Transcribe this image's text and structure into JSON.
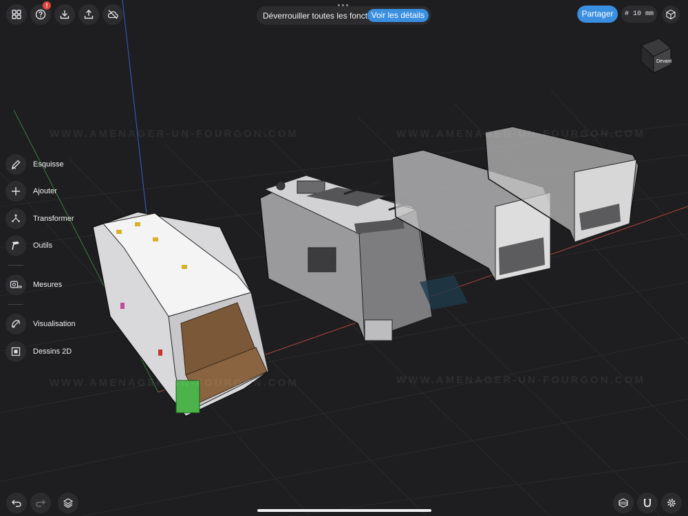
{
  "toolbar": {
    "left_icons": [
      "grid-icon",
      "help-icon",
      "download-icon",
      "upload-icon",
      "cloud-off-icon"
    ],
    "help_badge": "!",
    "unlock_text": "Déverrouiller toutes les fonctions",
    "details_label": "Voir les détails",
    "share_label": "Partager",
    "grid_size": "# 10 mm"
  },
  "view_cube": {
    "front_label": "Devant"
  },
  "tools": [
    {
      "label": "Esquisse",
      "icon": "pencil-icon"
    },
    {
      "label": "Ajouter",
      "icon": "plus-icon"
    },
    {
      "label": "Transformer",
      "icon": "transform-icon"
    },
    {
      "label": "Outils",
      "icon": "hammer-icon"
    },
    {
      "label": "Mesures",
      "icon": "tape-measure-icon"
    },
    {
      "label": "Visualisation",
      "icon": "visualisation-icon"
    },
    {
      "label": "Dessins 2D",
      "icon": "drawing-2d-icon"
    }
  ],
  "watermark": "WWW.AMENAGER-UN-FOURGON.COM",
  "bottom": {
    "left_icons": [
      "undo-icon",
      "redo-icon",
      "layers-icon"
    ],
    "right_icons": [
      "materials-icon",
      "magnet-icon",
      "settings-icon"
    ]
  },
  "colors": {
    "accent": "#3a8fe0",
    "background": "#1c1c1e",
    "button": "#2c2c2e",
    "badge": "#e0443c"
  }
}
